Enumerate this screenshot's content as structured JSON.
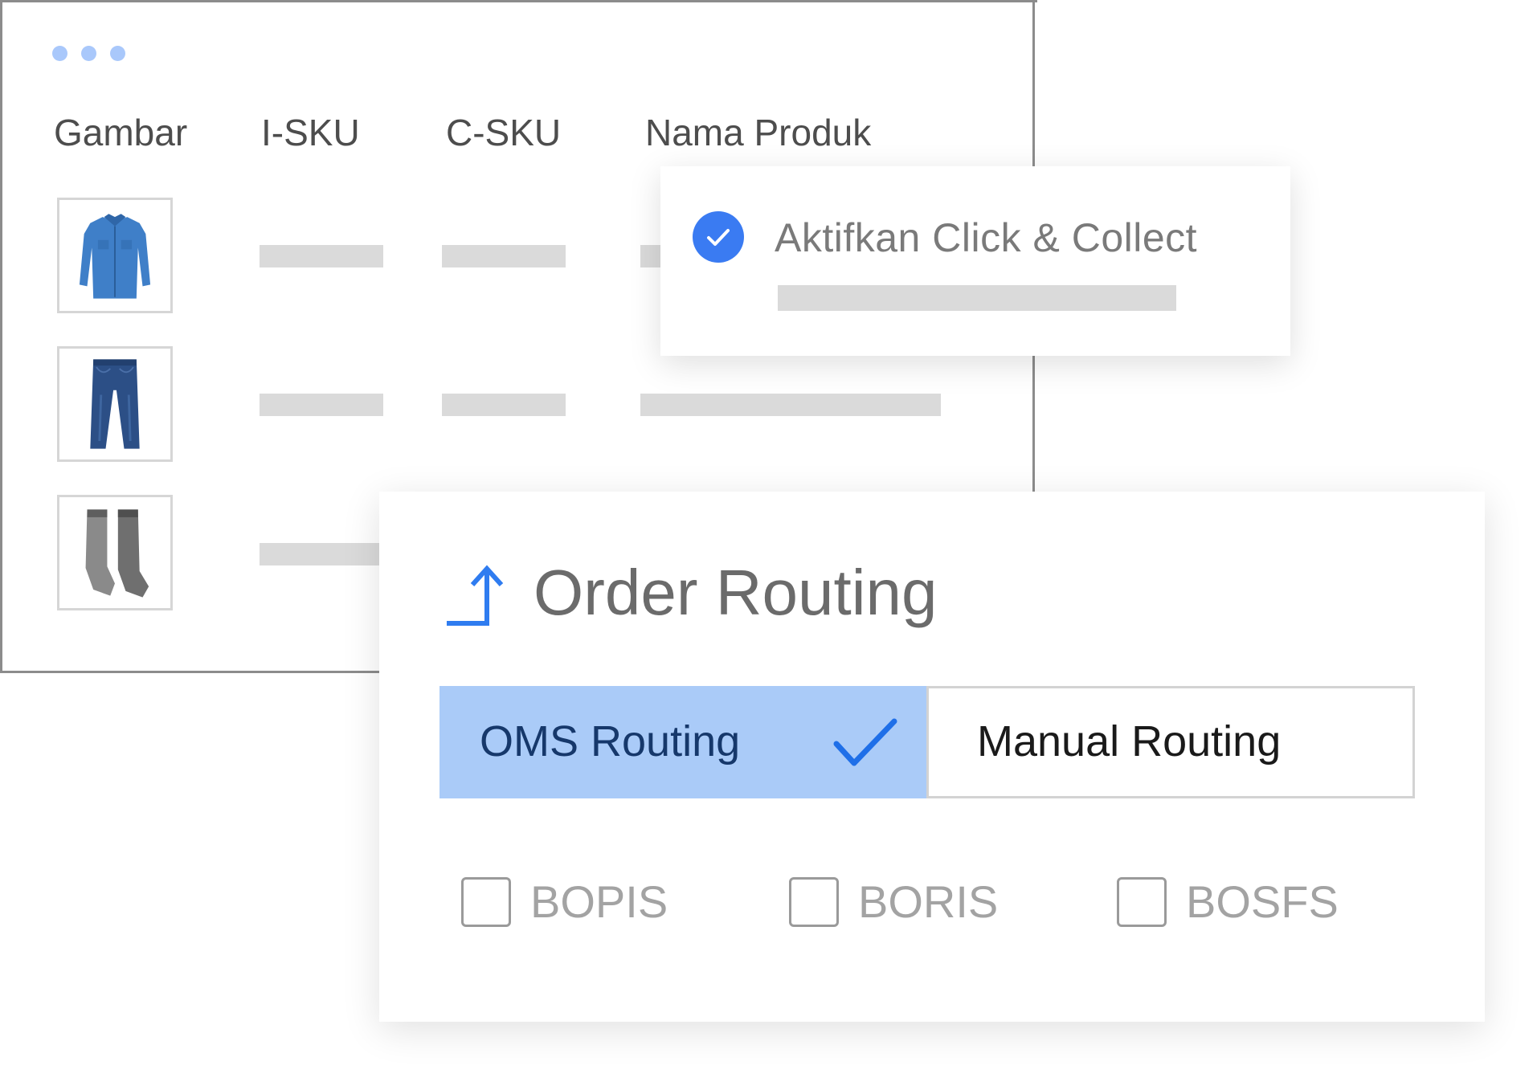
{
  "table": {
    "columns": [
      "Gambar",
      "I-SKU",
      "C-SKU",
      "Nama Produk"
    ],
    "rows": [
      {
        "image_icon": "blue-shirt-icon"
      },
      {
        "image_icon": "jeans-icon"
      },
      {
        "image_icon": "socks-icon"
      }
    ]
  },
  "click_collect": {
    "label": "Aktifkan Click & Collect",
    "checked": true
  },
  "order_routing": {
    "title": "Order Routing",
    "icon": "routing-arrow-icon",
    "tabs": [
      {
        "label": "OMS Routing",
        "selected": true
      },
      {
        "label": "Manual Routing",
        "selected": false
      }
    ],
    "options": [
      {
        "label": "BOPIS",
        "checked": false
      },
      {
        "label": "BORIS",
        "checked": false
      },
      {
        "label": "BOSFS",
        "checked": false
      }
    ]
  },
  "colors": {
    "accent": "#3a7bf2",
    "selected_tab_bg": "#aacbf8",
    "window_dots": "#a9c8fb"
  }
}
